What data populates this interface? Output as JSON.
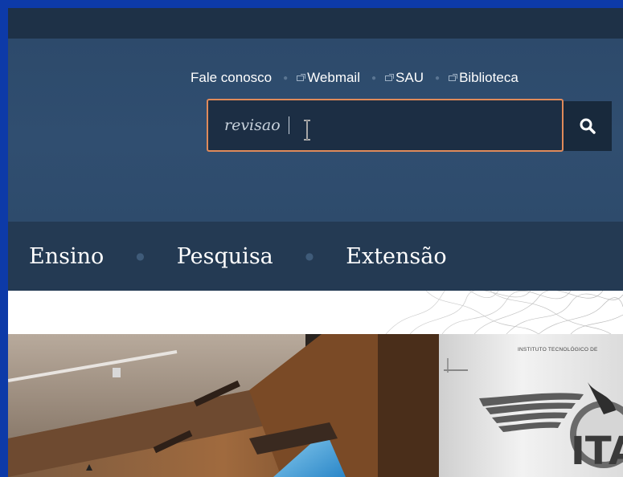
{
  "quicklinks": [
    {
      "label": "Fale conosco",
      "external": false
    },
    {
      "label": "Webmail",
      "external": true
    },
    {
      "label": "SAU",
      "external": true
    },
    {
      "label": "Biblioteca",
      "external": true
    }
  ],
  "search": {
    "value": "revisao",
    "button_icon": "search-icon"
  },
  "nav": {
    "items": [
      "Ensino",
      "Pesquisa",
      "Extensão"
    ]
  },
  "banner": {
    "right_caption": "INSTITUTO TECNOLÓGICO DE",
    "right_logo_text": "ITA"
  },
  "colors": {
    "outer_border": "#0d3aa8",
    "header_bg": "#2d4a6b",
    "nav_bg": "#243a53",
    "search_border": "#e08a5a"
  }
}
